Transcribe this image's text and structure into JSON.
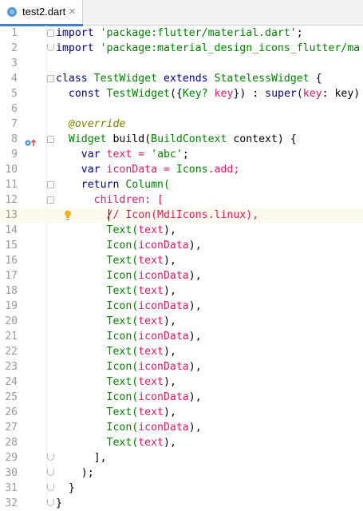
{
  "tab": {
    "title": "test2.dart",
    "close": "×"
  },
  "line_numbers": [
    "1",
    "2",
    "3",
    "4",
    "5",
    "6",
    "7",
    "8",
    "9",
    "10",
    "11",
    "12",
    "13",
    "14",
    "15",
    "16",
    "17",
    "18",
    "19",
    "20",
    "21",
    "22",
    "23",
    "24",
    "25",
    "26",
    "27",
    "28",
    "29",
    "30",
    "31",
    "32"
  ],
  "code": {
    "l1": {
      "kw": "import",
      "str": "'package:flutter/material.dart'",
      "tail": ";"
    },
    "l2": {
      "kw": "import",
      "str": "'package:material_design_icons_flutter/ma"
    },
    "l4": {
      "kw": "class",
      "name": "TestWidget",
      "kw2": "extends",
      "type": "StatelessWidget",
      "tail": "{"
    },
    "l5": {
      "kw": "const",
      "name": "TestWidget",
      "a": "({",
      "type": "Key?",
      "b": "key",
      "c": "})",
      "d": ":",
      "e": "super(",
      "f": "key",
      "g": ": key)"
    },
    "l7": {
      "ann": "@override"
    },
    "l8": {
      "type": "Widget",
      "a": "build(",
      "type2": "BuildContext",
      "b": "context) {"
    },
    "l9": {
      "kw": "var",
      "a": "text = ",
      "str": "'abc'",
      "tail": ";"
    },
    "l10": {
      "kw": "var",
      "a": "iconData = ",
      "type": "Icons",
      "b": ".add;"
    },
    "l11": {
      "kw": "return",
      "a": "Column("
    },
    "l12": {
      "a": "children: ["
    },
    "l13": {
      "comment": "// Icon(MdiIcons.linux),"
    },
    "text_line": {
      "fn": "Text(",
      "arg": "text",
      "tail": "),"
    },
    "icon_line": {
      "fn": "Icon(",
      "arg": "iconData",
      "tail": "),"
    },
    "l29": {
      "a": "],"
    },
    "l30": {
      "a": ");"
    },
    "l31": {
      "a": "}"
    },
    "l32": {
      "a": "}"
    }
  },
  "colors": {
    "keyword": "#000080",
    "string": "#008000",
    "type": "#008000",
    "comment": "#d81b60",
    "annotation": "#808000",
    "line_number": "#999999",
    "current_line": "#fcfaed",
    "tab_underline": "#4083c9"
  },
  "icons": [
    "dart-file-icon",
    "close-icon",
    "override-gutter-icon",
    "intention-bulb-icon",
    "fold-marker-icon"
  ]
}
